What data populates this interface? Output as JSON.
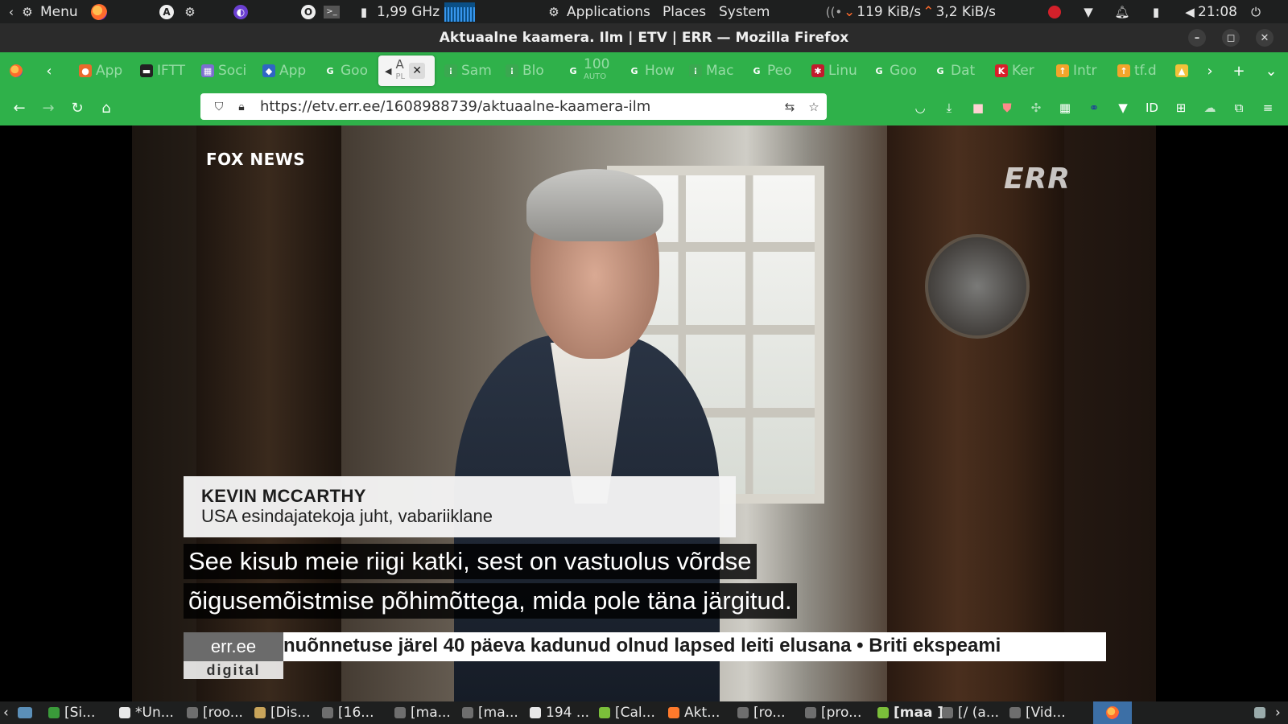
{
  "top_panel": {
    "menu_label": "Menu",
    "cpu_freq": "1,99 GHz",
    "applications_label": "Applications",
    "places_label": "Places",
    "system_label": "System",
    "net_down": "119 KiB/s",
    "net_up": "3,2 KiB/s",
    "clock": "21:08"
  },
  "window": {
    "title": "Aktuaalne kaamera. Ilm | ETV | ERR — Mozilla Firefox"
  },
  "tabs": [
    {
      "label": "App",
      "fav_color": "#e96a2c",
      "fav_char": "●"
    },
    {
      "label": "IFTT",
      "fav_color": "#222222",
      "fav_char": "▬"
    },
    {
      "label": "Soci",
      "fav_color": "#7b6fd0",
      "fav_char": "▦"
    },
    {
      "label": "App",
      "fav_color": "#2f66c5",
      "fav_char": "◆"
    },
    {
      "label": "Goo",
      "fav_color": "#ffffff",
      "fav_char": "G"
    },
    {
      "label": "A",
      "sub": "PL",
      "active": true
    },
    {
      "label": "Sam",
      "fav_color": "#3aa850",
      "fav_char": "⁝"
    },
    {
      "label": "Blo",
      "fav_color": "#3aa850",
      "fav_char": "⁝"
    },
    {
      "label": "100",
      "sub": "AUTO",
      "fav_color": "#ffffff",
      "fav_char": "G"
    },
    {
      "label": "How",
      "fav_color": "#ffffff",
      "fav_char": "G"
    },
    {
      "label": "Mac",
      "fav_color": "#3aa850",
      "fav_char": "⁝"
    },
    {
      "label": "Peo",
      "fav_color": "#ffffff",
      "fav_char": "G"
    },
    {
      "label": "Linu",
      "fav_color": "#c21b2d",
      "fav_char": "✱"
    },
    {
      "label": "Goo",
      "fav_color": "#ffffff",
      "fav_char": "G"
    },
    {
      "label": "Dat",
      "fav_color": "#ffffff",
      "fav_char": "G"
    },
    {
      "label": "Ker",
      "fav_color": "#d81f2a",
      "fav_char": "K"
    },
    {
      "label": "Intr",
      "fav_color": "#f3a52b",
      "fav_char": "↑"
    },
    {
      "label": "tf.d",
      "fav_color": "#f3a52b",
      "fav_char": "↑"
    },
    {
      "label": "",
      "fav_color": "#f2c23a",
      "fav_char": "▲"
    }
  ],
  "nav": {
    "url": "https://etv.err.ee/1608988739/aktuaalne-kaamera-ilm"
  },
  "video": {
    "fox_logo": "FOX NEWS",
    "err_logo": "ERR",
    "lower_third_name": "KEVIN MCCARTHY",
    "lower_third_role": "USA esindajatekoja juht, vabariiklane",
    "subtitle_line1": "See kisub meie riigi katki, sest on vastuolus võrdse",
    "subtitle_line2": "õigusemõistmise põhimõttega, mida pole täna järgitud.",
    "ticker_badge": "err.ee",
    "ticker_text": "nuõnnetuse järel 40 päeva kadunud olnud lapsed leiti elusana   •   Briti ekspeami",
    "digital_label": "digital"
  },
  "taskbar": [
    {
      "label": "[Si...",
      "color": "#3a9a3a"
    },
    {
      "label": "*Un...",
      "color": "#e8e8e8"
    },
    {
      "label": "[roo...",
      "color": "#6e6e6e"
    },
    {
      "label": "[Dis...",
      "color": "#c8a45a"
    },
    {
      "label": "[16...",
      "color": "#6e6e6e"
    },
    {
      "label": "[ma...",
      "color": "#6e6e6e"
    },
    {
      "label": "[ma...",
      "color": "#6e6e6e"
    },
    {
      "label": "194 ...",
      "color": "#e8e8e8"
    },
    {
      "label": "[Cal...",
      "color": "#7bbf3a"
    },
    {
      "label": "Akt...",
      "color": "#ff7a2c"
    },
    {
      "label": "[ro...",
      "color": "#6e6e6e"
    },
    {
      "label": "[pro...",
      "color": "#6e6e6e"
    },
    {
      "label": "[maa ]",
      "color": "#7bbf3a"
    },
    {
      "label": "[/ (a...",
      "color": "#6e6e6e"
    },
    {
      "label": "[Vid...",
      "color": "#6e6e6e"
    }
  ]
}
